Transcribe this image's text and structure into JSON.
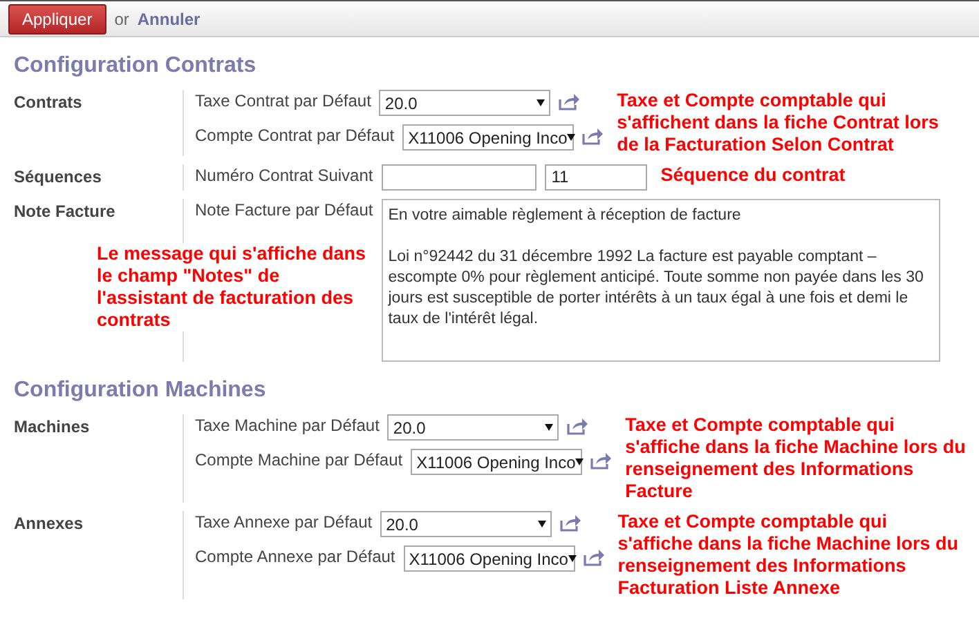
{
  "toolbar": {
    "apply": "Appliquer",
    "or": "or",
    "cancel": "Annuler"
  },
  "sections": [
    {
      "title": "Configuration Contrats",
      "groups": [
        {
          "label": "Contrats",
          "annotation": "Taxe et Compte comptable qui s'affichent dans la fiche Contrat lors de la Facturation Selon Contrat",
          "fields": [
            {
              "kind": "select",
              "label": "Taxe Contrat par Défaut",
              "value": "20.0"
            },
            {
              "kind": "select",
              "label": "Compte Contrat par Défaut",
              "value": "X11006 Opening Inco"
            }
          ]
        },
        {
          "label": "Séquences",
          "annotation": "Séquence du contrat",
          "fields": [
            {
              "kind": "pair",
              "label": "Numéro Contrat Suivant",
              "value": "11"
            }
          ]
        },
        {
          "label": "Note Facture",
          "annotation": "Le message qui s'affiche dans le champ \"Notes\" de l'assistant de facturation des contrats",
          "fields": [
            {
              "kind": "textarea",
              "label": "Note Facture par Défaut",
              "value": "En votre aimable règlement à réception de facture\n\nLoi n°92442 du 31 décembre 1992 La facture est payable comptant – escompte 0% pour règlement anticipé. Toute somme non payée dans les 30 jours est susceptible de porter intérêts à un taux égal à une fois et demi le taux de l'intérêt légal."
            }
          ]
        }
      ]
    },
    {
      "title": "Configuration Machines",
      "groups": [
        {
          "label": "Machines",
          "annotation": "Taxe et Compte comptable qui s'affiche dans la fiche Machine lors du renseignement des Informations Facture",
          "fields": [
            {
              "kind": "select",
              "label": "Taxe Machine par Défaut",
              "value": "20.0"
            },
            {
              "kind": "select",
              "label": "Compte Machine par Défaut",
              "value": "X11006 Opening Inco"
            }
          ]
        },
        {
          "label": "Annexes",
          "annotation": "Taxe et Compte comptable qui s'affiche dans la fiche Machine lors du renseignement des Informations Facturation Liste Annexe",
          "fields": [
            {
              "kind": "select",
              "label": "Taxe Annexe par Défaut",
              "value": "20.0"
            },
            {
              "kind": "select",
              "label": "Compte Annexe par Défaut",
              "value": "X11006 Opening Inco"
            }
          ]
        }
      ]
    }
  ]
}
